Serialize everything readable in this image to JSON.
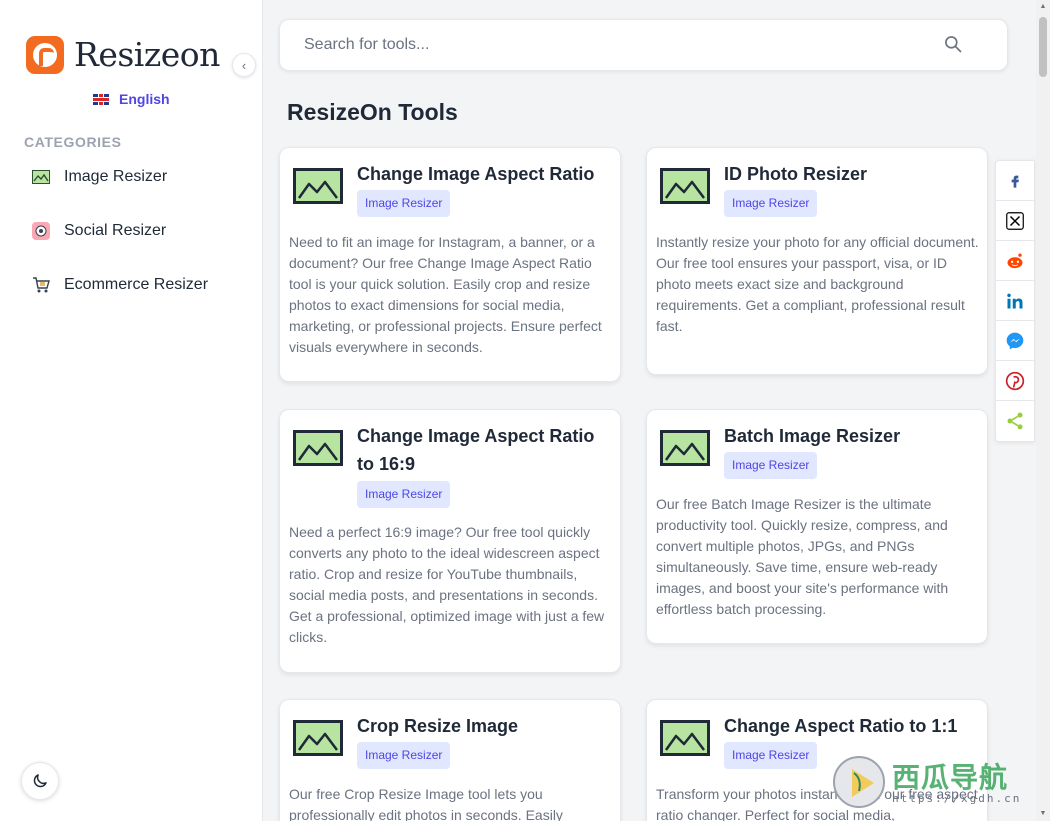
{
  "brand": {
    "name": "Resizeon"
  },
  "language": {
    "label": "English"
  },
  "sidebar": {
    "heading": "CATEGORIES",
    "items": [
      {
        "label": "Image Resizer",
        "icon": "image-icon"
      },
      {
        "label": "Social Resizer",
        "icon": "social-icon"
      },
      {
        "label": "Ecommerce Resizer",
        "icon": "cart-icon"
      }
    ]
  },
  "search": {
    "placeholder": "Search for tools..."
  },
  "main": {
    "title": "ResizeOn Tools"
  },
  "cards": [
    {
      "title": "Change Image Aspect Ratio",
      "badge": "Image Resizer",
      "description": "Need to fit an image for Instagram, a banner, or a document? Our free Change Image Aspect Ratio tool is your quick solution. Easily crop and resize photos to exact dimensions for social media, marketing, or professional projects. Ensure perfect visuals everywhere in seconds."
    },
    {
      "title": "ID Photo Resizer",
      "badge": "Image Resizer",
      "description": "Instantly resize your photo for any official document. Our free tool ensures your passport, visa, or ID photo meets exact size and background requirements. Get a compliant, professional result fast."
    },
    {
      "title": "Change Image Aspect Ratio to 16:9",
      "badge": "Image Resizer",
      "description": "Need a perfect 16:9 image? Our free tool quickly converts any photo to the ideal widescreen aspect ratio. Crop and resize for YouTube thumbnails, social media posts, and presentations in seconds. Get a professional, optimized image with just a few clicks."
    },
    {
      "title": "Batch Image Resizer",
      "badge": "Image Resizer",
      "description": "Our free Batch Image Resizer is the ultimate productivity tool. Quickly resize, compress, and convert multiple photos, JPGs, and PNGs simultaneously. Save time, ensure web-ready images, and boost your site's performance with effortless batch processing."
    },
    {
      "title": "Crop Resize Image",
      "badge": "Image Resizer",
      "description": "Our free Crop Resize Image tool lets you professionally edit photos in seconds. Easily"
    },
    {
      "title": "Change Aspect Ratio to 1:1",
      "badge": "Image Resizer",
      "description": "Transform your photos instantly with our free aspect ratio changer. Perfect for social media,"
    }
  ],
  "share": [
    {
      "icon": "facebook-icon",
      "color": "#3b5998"
    },
    {
      "icon": "x-icon",
      "color": "#000000"
    },
    {
      "icon": "reddit-icon",
      "color": "#ff4500"
    },
    {
      "icon": "linkedin-icon",
      "color": "#0077b5"
    },
    {
      "icon": "messenger-icon",
      "color": "#2196f3"
    },
    {
      "icon": "pinterest-icon",
      "color": "#cb2027"
    },
    {
      "icon": "share-icon",
      "color": "#95d03a"
    }
  ],
  "watermark": {
    "title": "西瓜导航",
    "url": "https://xgdh.cn"
  },
  "colors": {
    "accent": "#4f46e5",
    "brand": "#f26b21",
    "badge_bg": "#e0e7ff"
  }
}
